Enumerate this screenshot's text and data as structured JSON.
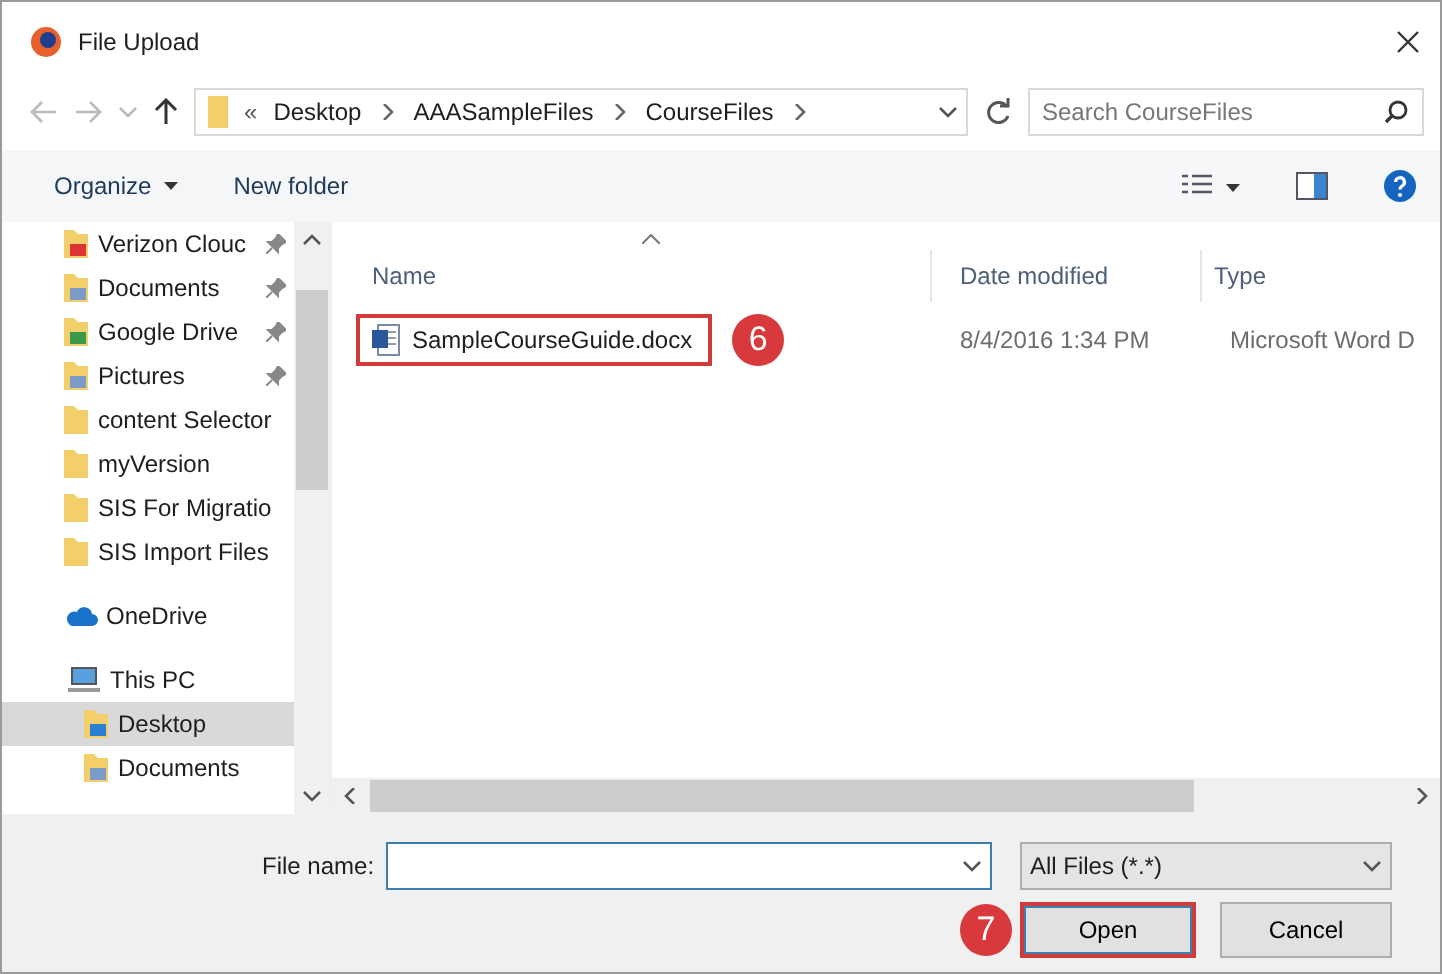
{
  "window": {
    "title": "File Upload"
  },
  "address_bar": {
    "overflow": "«",
    "crumbs": [
      "Desktop",
      "AAASampleFiles",
      "CourseFiles"
    ]
  },
  "search": {
    "placeholder": "Search CourseFiles"
  },
  "toolbar": {
    "organize": "Organize",
    "new_folder": "New folder"
  },
  "sidebar": {
    "pinned_items": [
      {
        "label": "Verizon Clouc",
        "kind": "cloud",
        "pinned": true,
        "selected": false
      },
      {
        "label": "Documents",
        "kind": "docs",
        "pinned": true,
        "selected": false
      },
      {
        "label": "Google Drive",
        "kind": "drive",
        "pinned": true,
        "selected": false
      },
      {
        "label": "Pictures",
        "kind": "pics",
        "pinned": true,
        "selected": false
      },
      {
        "label": "content Selector",
        "kind": "folder",
        "pinned": false,
        "selected": false
      },
      {
        "label": "myVersion",
        "kind": "folder",
        "pinned": false,
        "selected": false
      },
      {
        "label": "SIS For Migratio",
        "kind": "folder",
        "pinned": false,
        "selected": false
      },
      {
        "label": "SIS Import Files",
        "kind": "folder",
        "pinned": false,
        "selected": false
      }
    ],
    "locations": [
      {
        "label": "OneDrive",
        "kind": "onedrive",
        "selected": false
      },
      {
        "label": "This PC",
        "kind": "pc",
        "selected": false,
        "children": [
          {
            "label": "Desktop",
            "kind": "desktop",
            "selected": true
          },
          {
            "label": "Documents",
            "kind": "docs",
            "selected": false
          }
        ]
      }
    ]
  },
  "table": {
    "columns": [
      "Name",
      "Date modified",
      "Type"
    ],
    "rows": [
      {
        "name": "SampleCourseGuide.docx",
        "date": "8/4/2016 1:34 PM",
        "type": "Microsoft Word D",
        "highlighted": true,
        "callout": "6"
      }
    ]
  },
  "footer": {
    "file_name_label": "File name:",
    "filter": "All Files (*.*)",
    "buttons": [
      {
        "label": "Open",
        "highlighted": true,
        "callout": "7"
      },
      {
        "label": "Cancel",
        "highlighted": false
      }
    ]
  }
}
